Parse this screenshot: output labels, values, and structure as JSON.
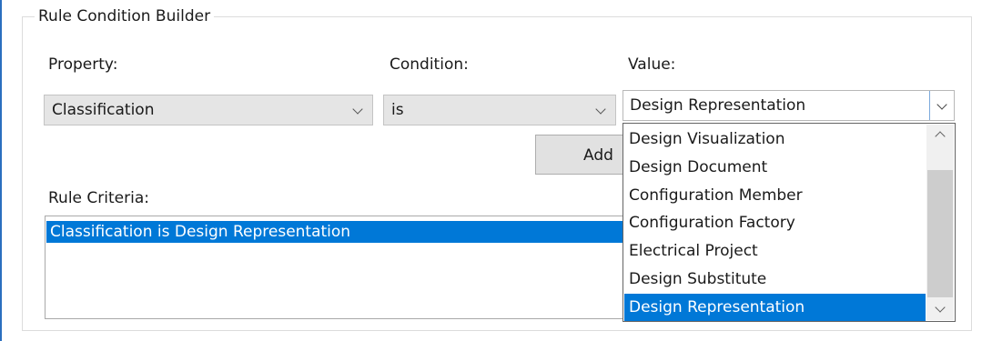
{
  "group": {
    "title": "Rule Condition Builder"
  },
  "property": {
    "label": "Property:",
    "value": "Classification"
  },
  "condition": {
    "label": "Condition:",
    "value": "is"
  },
  "value": {
    "label": "Value:",
    "selected": "Design Representation",
    "options": [
      "Design Visualization",
      "Design Document",
      "Configuration Member",
      "Configuration Factory",
      "Electrical Project",
      "Design Substitute",
      "Design Representation"
    ],
    "selected_index": 6
  },
  "add_button": {
    "label": "Add"
  },
  "criteria": {
    "label": "Rule Criteria:",
    "items": [
      "Classification is Design Representation"
    ]
  },
  "colors": {
    "selection": "#0078d7",
    "accent_edge": "#2b6fbf"
  }
}
